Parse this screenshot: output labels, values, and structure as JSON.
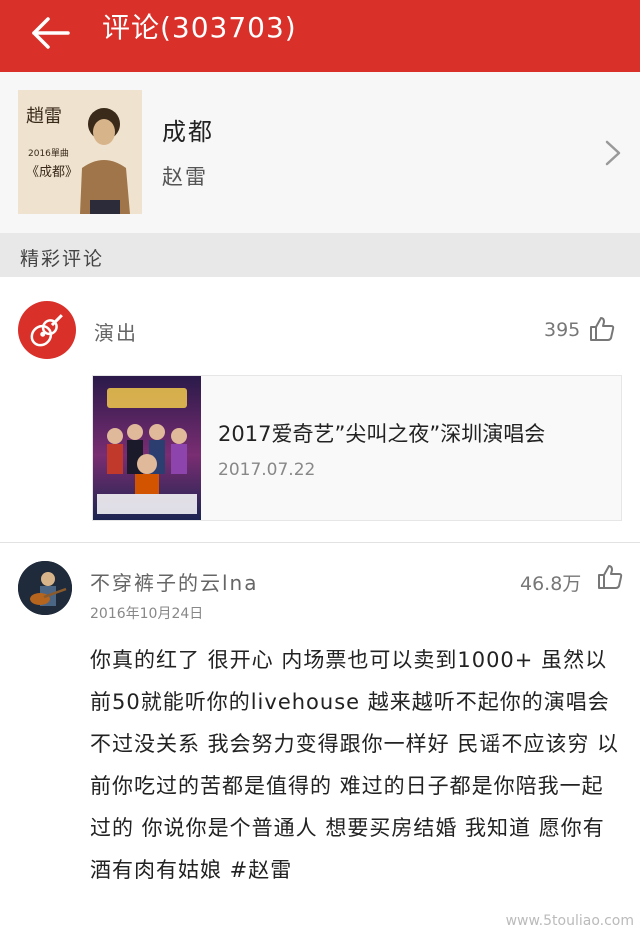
{
  "header": {
    "title": "评论(303703)",
    "back_icon": "arrow-left-icon"
  },
  "song": {
    "title": "成都",
    "artist": "赵雷"
  },
  "section": {
    "title": "精彩评论"
  },
  "comment1": {
    "user": "演出",
    "likes": "395",
    "event": {
      "title": "2017爱奇艺”尖叫之夜”深圳演唱会",
      "date": "2017.07.22"
    }
  },
  "comment2": {
    "user": "不穿裤子的云lna",
    "likes": "46.8万",
    "date": "2016年10月24日",
    "text": "你真的红了 很开心 内场票也可以卖到1000+ 虽然以前50就能听你的livehouse 越来越听不起你的演唱会 不过没关系 我会努力变得跟你一样好 民谣不应该穷 以前你吃过的苦都是值得的 难过的日子都是你陪我一起过的 你说你是个普通人 想要买房结婚 我知道 愿你有酒有肉有姑娘 #赵雷"
  },
  "watermark": "www.5touliao.com",
  "colors": {
    "accent": "#d9302a",
    "section_bg": "#e8e8e8"
  }
}
